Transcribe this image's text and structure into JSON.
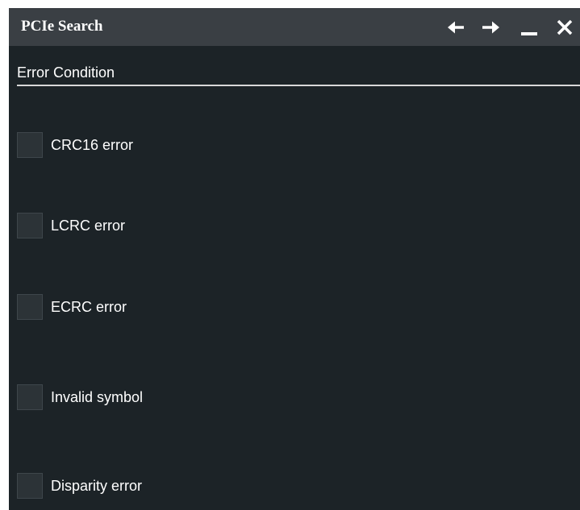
{
  "dialog": {
    "title": "PCIe Search",
    "controls": [
      {
        "name": "back-arrow-icon",
        "icon": "arrow-left"
      },
      {
        "name": "forward-arrow-icon",
        "icon": "arrow-right"
      },
      {
        "name": "minimize-icon",
        "icon": "minus"
      },
      {
        "name": "close-icon",
        "icon": "x"
      }
    ]
  },
  "section": {
    "title": "Error Condition"
  },
  "options": [
    {
      "label": "CRC16 error",
      "checked": false
    },
    {
      "label": "LCRC error",
      "checked": false
    },
    {
      "label": "ECRC error",
      "checked": false
    },
    {
      "label": "Invalid symbol",
      "checked": false
    },
    {
      "label": "Disparity error",
      "checked": false
    }
  ],
  "colors": {
    "background": "#1c2327",
    "titlebar": "#3a3f44",
    "text": "#ffffff",
    "checkbox": "#2c3337"
  }
}
